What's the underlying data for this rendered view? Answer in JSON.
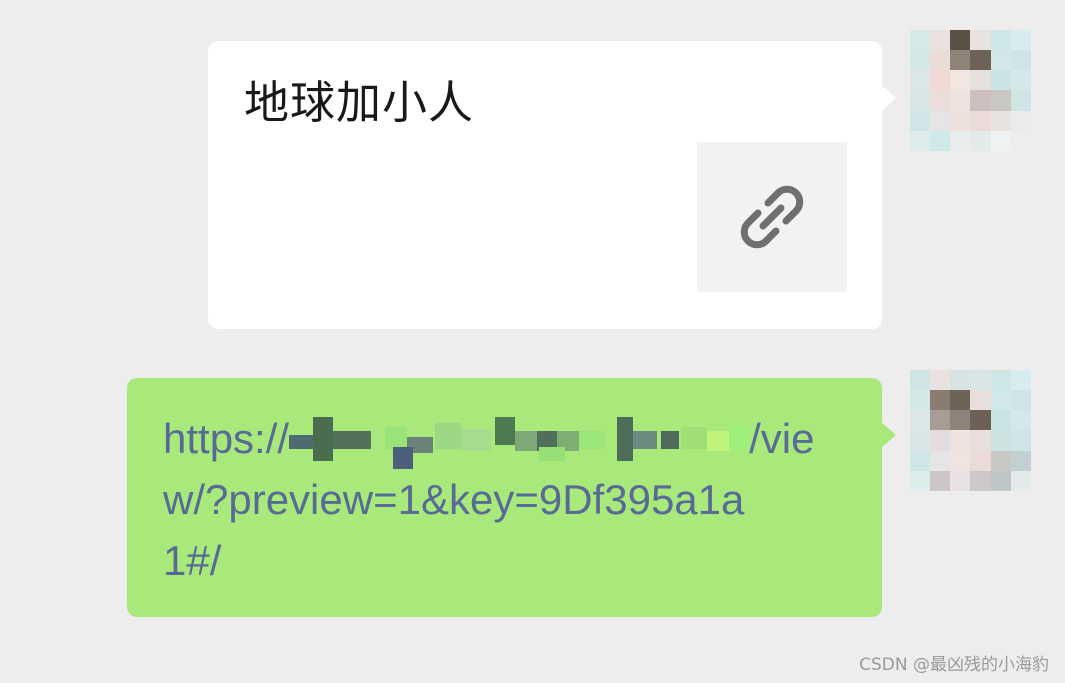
{
  "messages": {
    "link_card": {
      "title": "地球加小人",
      "icon": "link-icon",
      "bubble_color": "#ffffff"
    },
    "url_message": {
      "prefix": "https://",
      "line1_suffix": "/vie",
      "line2": "w/?preview=1&key=9Df395a1a",
      "line3": "1#/",
      "bubble_color": "#a9e97c",
      "text_color": "#576b95"
    }
  },
  "colors": {
    "background": "#ededed",
    "thumb_background": "#f2f2f2"
  },
  "watermark": "CSDN @最凶残的小海豹"
}
